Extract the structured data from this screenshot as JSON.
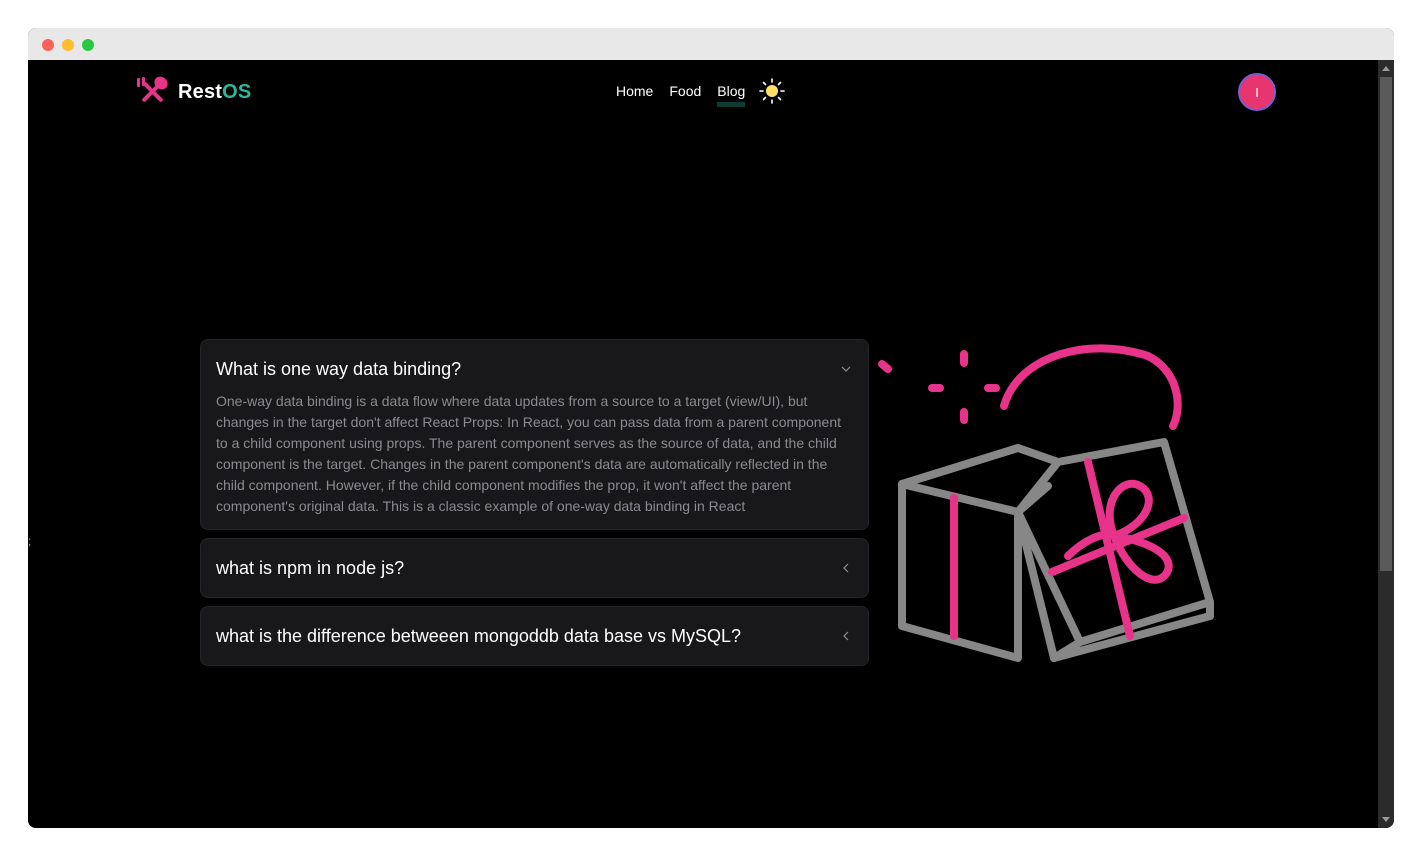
{
  "brand": {
    "name_main": "Rest",
    "name_accent": "OS",
    "accent_color": "#2eb69a",
    "icon": "fork-spoon-icon"
  },
  "nav": {
    "items": [
      {
        "label": "Home",
        "active": false
      },
      {
        "label": "Food",
        "active": false
      },
      {
        "label": "Blog",
        "active": true
      }
    ],
    "theme_toggle_icon": "sun-icon"
  },
  "user": {
    "avatar_initial": "I",
    "avatar_color": "#e7366f"
  },
  "faq": {
    "items": [
      {
        "question": "What is one way data binding?",
        "expanded": true,
        "chevron": "chevron-down-icon",
        "answer": "One-way data binding is a data flow where data updates from a source to a target (view/UI), but changes in the target don't affect React Props: In React, you can pass data from a parent component to a child component using props. The parent component serves as the source of data, and the child component is the target. Changes in the parent component's data are automatically reflected in the child component. However, if the child component modifies the prop, it won't affect the parent component's original data. This is a classic example of one-way data binding in React"
      },
      {
        "question": "what is npm in node js?",
        "expanded": false,
        "chevron": "chevron-left-icon"
      },
      {
        "question": "what is the difference betweeen mongoddb data base vs MySQL?",
        "expanded": false,
        "chevron": "chevron-left-icon"
      }
    ]
  },
  "illustration": {
    "name": "gift-box-illustration",
    "stroke_color": "#878787",
    "accent_color": "#e8338a"
  },
  "stray_mark": ";"
}
